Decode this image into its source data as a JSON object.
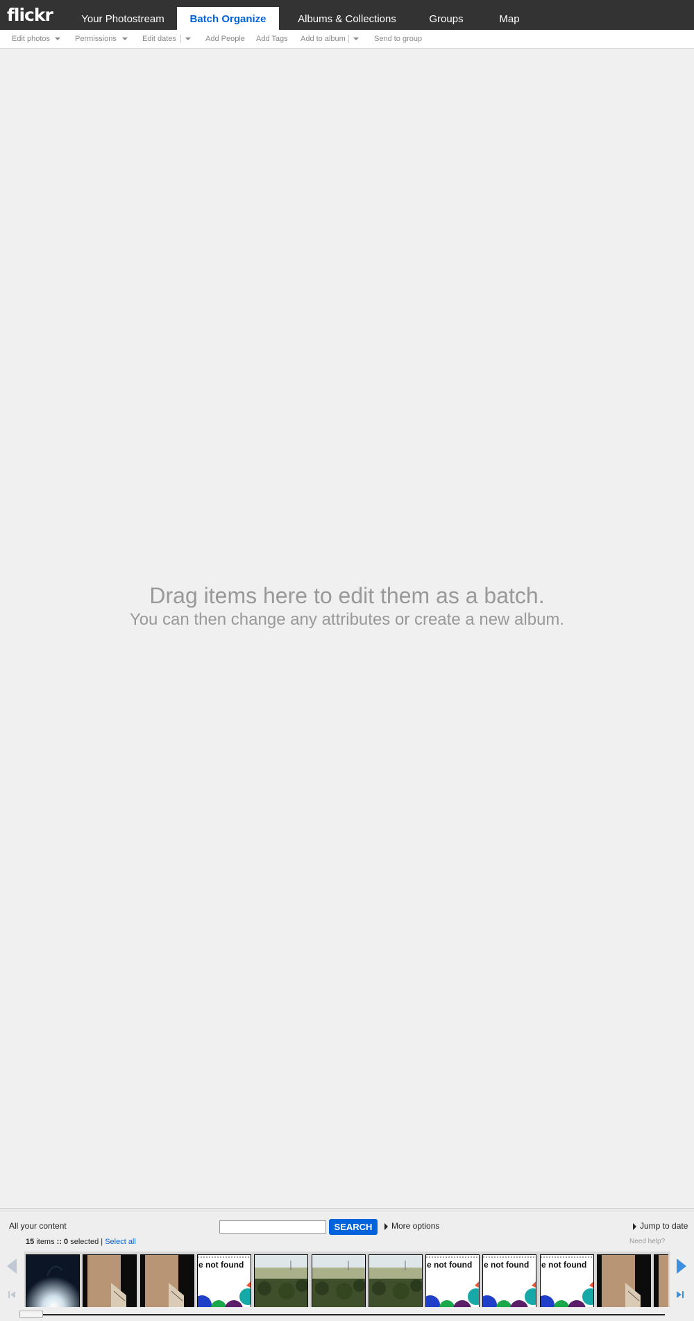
{
  "header": {
    "logo": "flickr",
    "tabs": [
      "Your Photostream",
      "Batch Organize",
      "Albums & Collections",
      "Groups",
      "Map"
    ],
    "active_tab": "Batch Organize"
  },
  "toolbar": {
    "edit_photos": "Edit photos",
    "permissions": "Permissions",
    "edit_dates": "Edit dates",
    "add_people": "Add People",
    "add_tags": "Add Tags",
    "add_to_album": "Add to album",
    "send_to_group": "Send to group"
  },
  "batch_area": {
    "title": "Drag items here to edit them as a batch.",
    "subtitle": "You can then change any attributes or create a new album."
  },
  "organizer": {
    "scope": "All your content",
    "search": {
      "value": "",
      "placeholder": "",
      "button": "SEARCH"
    },
    "more_options": "More options",
    "jump_to_date": "Jump to date",
    "status": {
      "items": "15",
      "items_label": "items",
      "separator": "::",
      "selected": "0",
      "selected_label": "selected |",
      "select_all": "Select all"
    },
    "need_help": "Need help?",
    "thumbnails": [
      {
        "kind": "lamp"
      },
      {
        "kind": "wood"
      },
      {
        "kind": "wood"
      },
      {
        "kind": "not-found",
        "text": "e not found"
      },
      {
        "kind": "landscape"
      },
      {
        "kind": "landscape"
      },
      {
        "kind": "landscape"
      },
      {
        "kind": "not-found",
        "text": "e not found"
      },
      {
        "kind": "not-found",
        "text": "e not found"
      },
      {
        "kind": "not-found",
        "text": "e not found"
      },
      {
        "kind": "wood"
      },
      {
        "kind": "wood"
      }
    ],
    "colors": {
      "accent": "#0063dc",
      "nav_bg": "#333333",
      "page_bg": "#f0f0f0"
    }
  }
}
